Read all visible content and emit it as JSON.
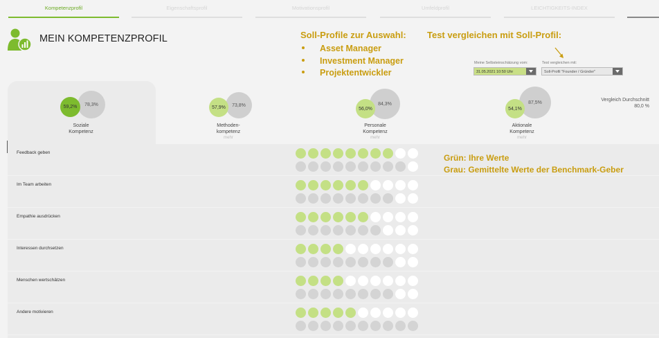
{
  "nav": {
    "tabs": [
      {
        "label": "Kompetenzprofil",
        "active": true
      },
      {
        "label": "Eigenschaftsprofil",
        "active": false
      },
      {
        "label": "Motivationsprofil",
        "active": false
      },
      {
        "label": "Umfeldprofil",
        "active": false
      },
      {
        "label": "LEICHTIGKEITS-INDEX",
        "active": false
      }
    ]
  },
  "header": {
    "title": "MEIN KOMPETENZPROFIL",
    "icon": "person-chart-icon"
  },
  "annotations": {
    "soll_title": "Soll-Profile zur Auswahl:",
    "soll_items": [
      "Asset Manager",
      "Investment Manager",
      "Projektentwickler"
    ],
    "test_title": "Test vergleichen mit Soll-Profil:",
    "legend_green": "Grün: Ihre Werte",
    "legend_gray": "Grau: Gemittelte Werte der Benchmark-Geber"
  },
  "selectors": {
    "self_label": "Meine Selbsteinschätzung vom:",
    "self_value": "31.05.2021 10:50 Uhr",
    "compare_label": "Test vergleichen mit:",
    "compare_value": "Soll-Profil \"Founder / Gründer\""
  },
  "competencies": [
    {
      "name_line1": "Soziale",
      "name_line2": "Kompetenz",
      "user": "59,2%",
      "user_value": 59.2,
      "bench": "78,3%",
      "bench_value": 78.3,
      "more": "",
      "selected": true
    },
    {
      "name_line1": "Methoden-",
      "name_line2": "kompetenz",
      "user": "57,9%",
      "user_value": 57.9,
      "bench": "73,8%",
      "bench_value": 73.8,
      "more": "mehr",
      "selected": false
    },
    {
      "name_line1": "Personale",
      "name_line2": "Kompetenz",
      "user": "56,0%",
      "user_value": 56.0,
      "bench": "84,3%",
      "bench_value": 84.3,
      "more": "mehr",
      "selected": false
    },
    {
      "name_line1": "Aktionale",
      "name_line2": "Kompetenz",
      "user": "54,1%",
      "user_value": 54.1,
      "bench": "87,5%",
      "bench_value": 87.5,
      "more": "mehr",
      "selected": false
    }
  ],
  "vergleich": {
    "label": "Vergleich Durchschnitt",
    "value": "80,0 %"
  },
  "colors": {
    "accent_green": "#7dbb2e",
    "user_green": "#c4e085",
    "bench_gray": "#d4d4d4",
    "annotation_gold": "#c99d10"
  },
  "scale_max": 10,
  "rows": [
    {
      "label": "Feedback geben",
      "user": 8,
      "bench": 9
    },
    {
      "label": "Im Team arbeiten",
      "user": 6,
      "bench": 8
    },
    {
      "label": "Empathie ausdrücken",
      "user": 6,
      "bench": 7
    },
    {
      "label": "Interessen durchsetzen",
      "user": 4,
      "bench": 8
    },
    {
      "label": "Menschen wertschätzen",
      "user": 4,
      "bench": 8
    },
    {
      "label": "Andere motivieren",
      "user": 5,
      "bench": 10
    }
  ]
}
